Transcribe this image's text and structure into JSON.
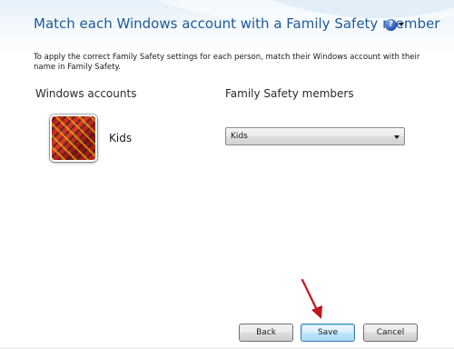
{
  "window": {
    "title": "Match each Windows account with a Family Safety member"
  },
  "intro_text": "To apply the correct Family Safety settings for each person, match their Windows account with their name in Family Safety.",
  "columns": {
    "accounts_header": "Windows accounts",
    "members_header": "Family Safety members"
  },
  "accounts": [
    {
      "name": "Kids",
      "avatar_icon": "red-pattern-avatar",
      "selected_member": "Kids"
    }
  ],
  "icons": {
    "help": "?"
  },
  "buttons": {
    "back": "Back",
    "save": "Save",
    "cancel": "Cancel"
  },
  "colors": {
    "title": "#1e5a96",
    "annotation_arrow": "#c0161c",
    "save_button_accent": "#3c7fb1"
  }
}
